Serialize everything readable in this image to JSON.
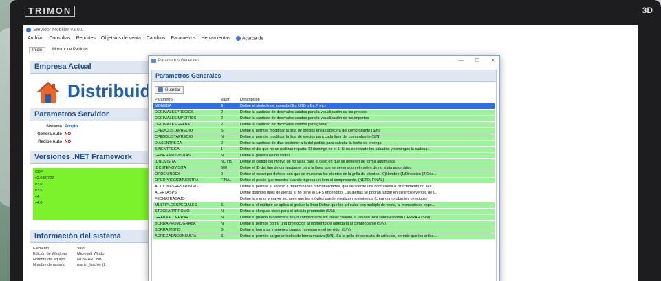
{
  "monitor": {
    "brand": "TRIMON",
    "badge": "3D"
  },
  "app": {
    "title": "Servidor Mobiliar v3.0.0",
    "menu": [
      "Archivo",
      "Consultas",
      "Reportes",
      "Objetivos de venta",
      "Cambios",
      "Parametros",
      "Herramientas",
      "Acerca de"
    ],
    "tabs": [
      "Inicio",
      "Monitor de Pedidos"
    ]
  },
  "left": {
    "empresa_header": "Empresa Actual",
    "company_name": "Distribuido",
    "servidor_header": "Parametros Servidor",
    "servidor": [
      {
        "k": "Sistema",
        "v": "Propio"
      },
      {
        "k": "Genera Auto",
        "v": "NO"
      },
      {
        "k": "Recibe Auto",
        "v": "NO"
      }
    ],
    "net_header": "Versiones .NET Framework",
    "net_versions": [
      "CDF",
      "v2.0.50727",
      "v3.0",
      "v3.5",
      "v4",
      "v4.0"
    ],
    "sys_header": "Información del sistema",
    "sys_cols": [
      "Elemento",
      "Valor"
    ],
    "sys_rows": [
      [
        "Edición de Windows",
        "Microsoft Windo"
      ],
      [
        "Nombre del equipo",
        "NTBMARTINB"
      ],
      [
        "Nombre de usuario",
        "martin_larcher (L"
      ]
    ]
  },
  "dialog": {
    "window_title": "Parametros Generales",
    "controls": [
      "—",
      "☐",
      "✕"
    ],
    "header": "Parametros Generales",
    "save_label": "Guardar",
    "columns": [
      "Parámetro",
      "Valor",
      "Descripción"
    ],
    "rows": [
      {
        "p": "MONEDA",
        "v": "$",
        "d": "Define el símbolo de moneda ($ o USD o Bs.F, etc)",
        "s": "sel"
      },
      {
        "p": "DECIMALESPRECIOS",
        "v": "2",
        "d": "Define la cantidad de decimales usados para la visualización de los precios",
        "s": "g"
      },
      {
        "p": "DECIMALESIMPORTES",
        "v": "2",
        "d": "Define la cantidad de decimales usados para la visualización de los importes",
        "s": "g"
      },
      {
        "p": "DECIMALESGRABA",
        "v": "2",
        "d": "Define la cantidad de decimales usados para grabar",
        "s": "g"
      },
      {
        "p": "CPEDCLISTAPRECIO",
        "v": "S",
        "d": "Define si permite modificar la lista de precios en la cabecera del comprobante (S/N)",
        "s": "g"
      },
      {
        "p": "CPEDDLISTAPRECIO",
        "v": "N",
        "d": "Define si permite modificar la lista de precios para cada ítem del comprobante (S/N)",
        "s": "g"
      },
      {
        "p": "DIASENTREGA",
        "v": "0",
        "d": "Define la cantidad de días posterior a la del pedido para calcular la fecha de entrega",
        "s": "g"
      },
      {
        "p": "SINENTREGA",
        "v": "1",
        "d": "Define el día que no se realizan reparto. El domingo es el 1. Si no se reparte los sabados y domingos la cadena...",
        "s": "g"
      },
      {
        "p": "GENERANOVISITAS",
        "v": "N",
        "d": "Define si genera las no visitas",
        "s": "g"
      },
      {
        "p": "IDNOVISITA",
        "v": "NOVIS",
        "d": "Define el código del motivo de no visita para el caso en que se generen de forma automática",
        "s": "g"
      },
      {
        "p": "IDCBTENOVISITA",
        "v": "500",
        "d": "Define el ID del tipo de comprobante para la línea que se genera con el motivo de no visita automático",
        "s": "g"
      },
      {
        "p": "ORDENINDEX",
        "v": "0",
        "d": "Define el orden por defecto con que se muestran los clientes en la grilla de clientes. (0)Nombre (1)Dirección (2)Cód...",
        "s": "g"
      },
      {
        "p": "OPEDPRECIOMUESTRA",
        "v": "FINAL",
        "d": "Define el precio que muestra cuando ingresa un ítem al comprobante. (NETO, FINAL)",
        "s": "g"
      },
      {
        "p": "ACCIONESRESTRINGID...",
        "v": "",
        "d": "Define si permite el acceso a determinadas funcionalidades, que se solicite una contraseña o directamente no sea...",
        "s": "w"
      },
      {
        "p": "ALERTASPS",
        "v": "",
        "d": "Define distintos tipos de alertas si no tiene el GPS encendido. Las alertas se podrán lanzar en distintos eventos de l...",
        "s": "w"
      },
      {
        "p": "FECHATRABAJO",
        "v": "",
        "d": "Define la menor y mayor fecha en que los móviles pueden realizar movimientos (crear comprobantes o recibos)",
        "s": "w"
      },
      {
        "p": "MULTIPLOESPECIALES",
        "v": "S",
        "d": "Define si el múltiplo se aplica al grabar la línea Define que los artículos con múltiplo de venta, al momento de espe...",
        "s": "g"
      },
      {
        "p": "STOCKARTPROMO",
        "v": "N",
        "d": "Define si chequea stock para el artículo promoción (S/N)",
        "s": "g"
      },
      {
        "p": "GRABAALCERRAR",
        "v": "N",
        "d": "Define si guarda la cabecera de un comprobante sin líneas cuando el usuario toca sobre el botón CERRAR (S/N)",
        "s": "g"
      },
      {
        "p": "BORRAPROMOGRABA",
        "v": "N",
        "d": "Define si permite borrar una promoción al momento de agregarla al comprobante (S/N)",
        "s": "g"
      },
      {
        "p": "BORRAIMGNS",
        "v": "S",
        "d": "Define si borra las imágenes cuando no están en el servidor (S/N)",
        "s": "g"
      },
      {
        "p": "AGREGAENCONSULTA",
        "v": "S",
        "d": "Define si permite cargar artículos de forma masiva (S/N). En la grilla de consulta de artículos, permite que los artícu...",
        "s": "g"
      }
    ]
  },
  "colors": {
    "selected": "#2e6ee6",
    "green_row": "#9ef29e",
    "net_box": "#7bf22c",
    "accent": "#1f5fae"
  }
}
